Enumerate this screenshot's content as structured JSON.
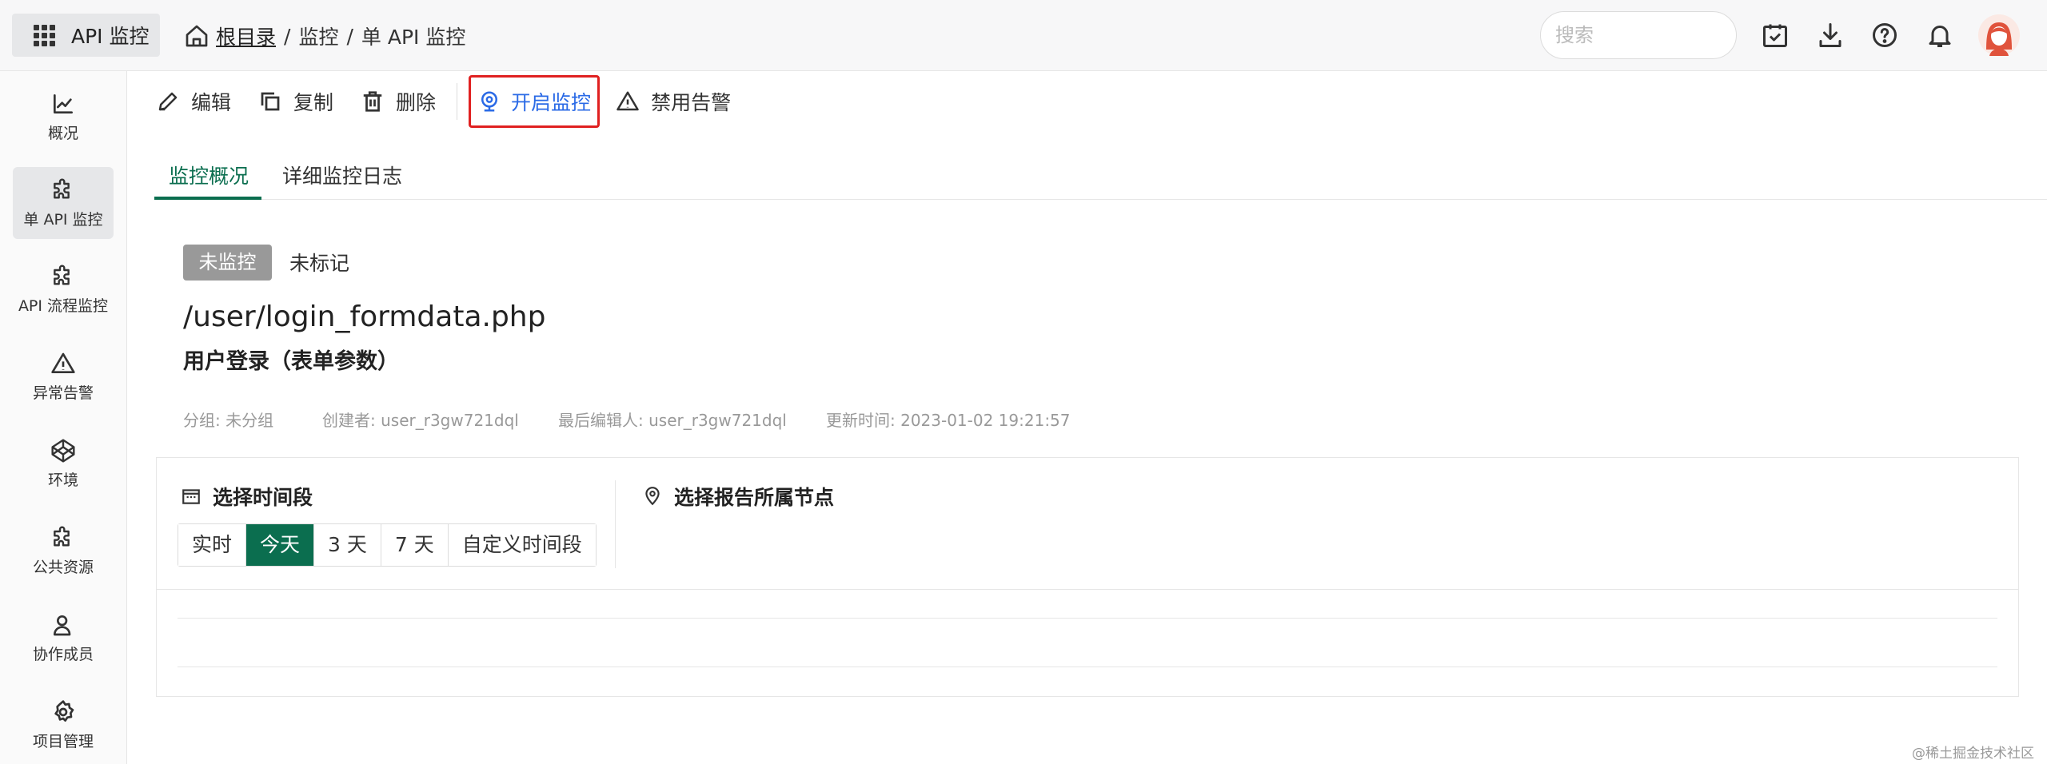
{
  "header": {
    "app_name": "API 监控",
    "breadcrumb": {
      "root": "根目录",
      "sep1": "/",
      "item1": "监控",
      "sep2": "/",
      "item2": "单 API 监控"
    },
    "search_placeholder": "搜索",
    "icons": [
      "calendar-check-icon",
      "download-icon",
      "help-icon",
      "bell-icon",
      "user-avatar"
    ]
  },
  "sidebar": {
    "items": [
      {
        "label": "概况",
        "icon": "line-chart-icon"
      },
      {
        "label": "单 API 监控",
        "icon": "puzzle-icon",
        "active": true
      },
      {
        "label": "API 流程监控",
        "icon": "puzzle-icon"
      },
      {
        "label": "异常告警",
        "icon": "warning-icon"
      },
      {
        "label": "环境",
        "icon": "codepen-icon"
      },
      {
        "label": "公共资源",
        "icon": "puzzle-icon"
      },
      {
        "label": "协作成员",
        "icon": "user-icon"
      },
      {
        "label": "项目管理",
        "icon": "gear-icon"
      }
    ]
  },
  "toolbar": {
    "edit": "编辑",
    "copy": "复制",
    "delete": "删除",
    "start_monitor": "开启监控",
    "disable_alert": "禁用告警"
  },
  "tabs": {
    "overview": "监控概况",
    "log": "详细监控日志"
  },
  "status": {
    "badge": "未监控",
    "marker": "未标记"
  },
  "api": {
    "path": "/user/login_formdata.php",
    "title": "用户登录（表单参数）"
  },
  "meta": {
    "group": "分组: 未分组",
    "creator": "创建者: user_r3gw721dql",
    "editor": "最后编辑人: user_r3gw721dql",
    "updated": "更新时间:  2023-01-02 19:21:57"
  },
  "panel": {
    "time_title": "选择时间段",
    "node_title": "选择报告所属节点",
    "ranges": [
      "实时",
      "今天",
      "3 天",
      "7 天",
      "自定义时间段"
    ],
    "selected_range": "今天"
  },
  "colors": {
    "accent": "#0b6e4f",
    "link": "#2a6ae6",
    "highlight_border": "#e02020"
  },
  "watermark": "@稀土掘金技术社区"
}
